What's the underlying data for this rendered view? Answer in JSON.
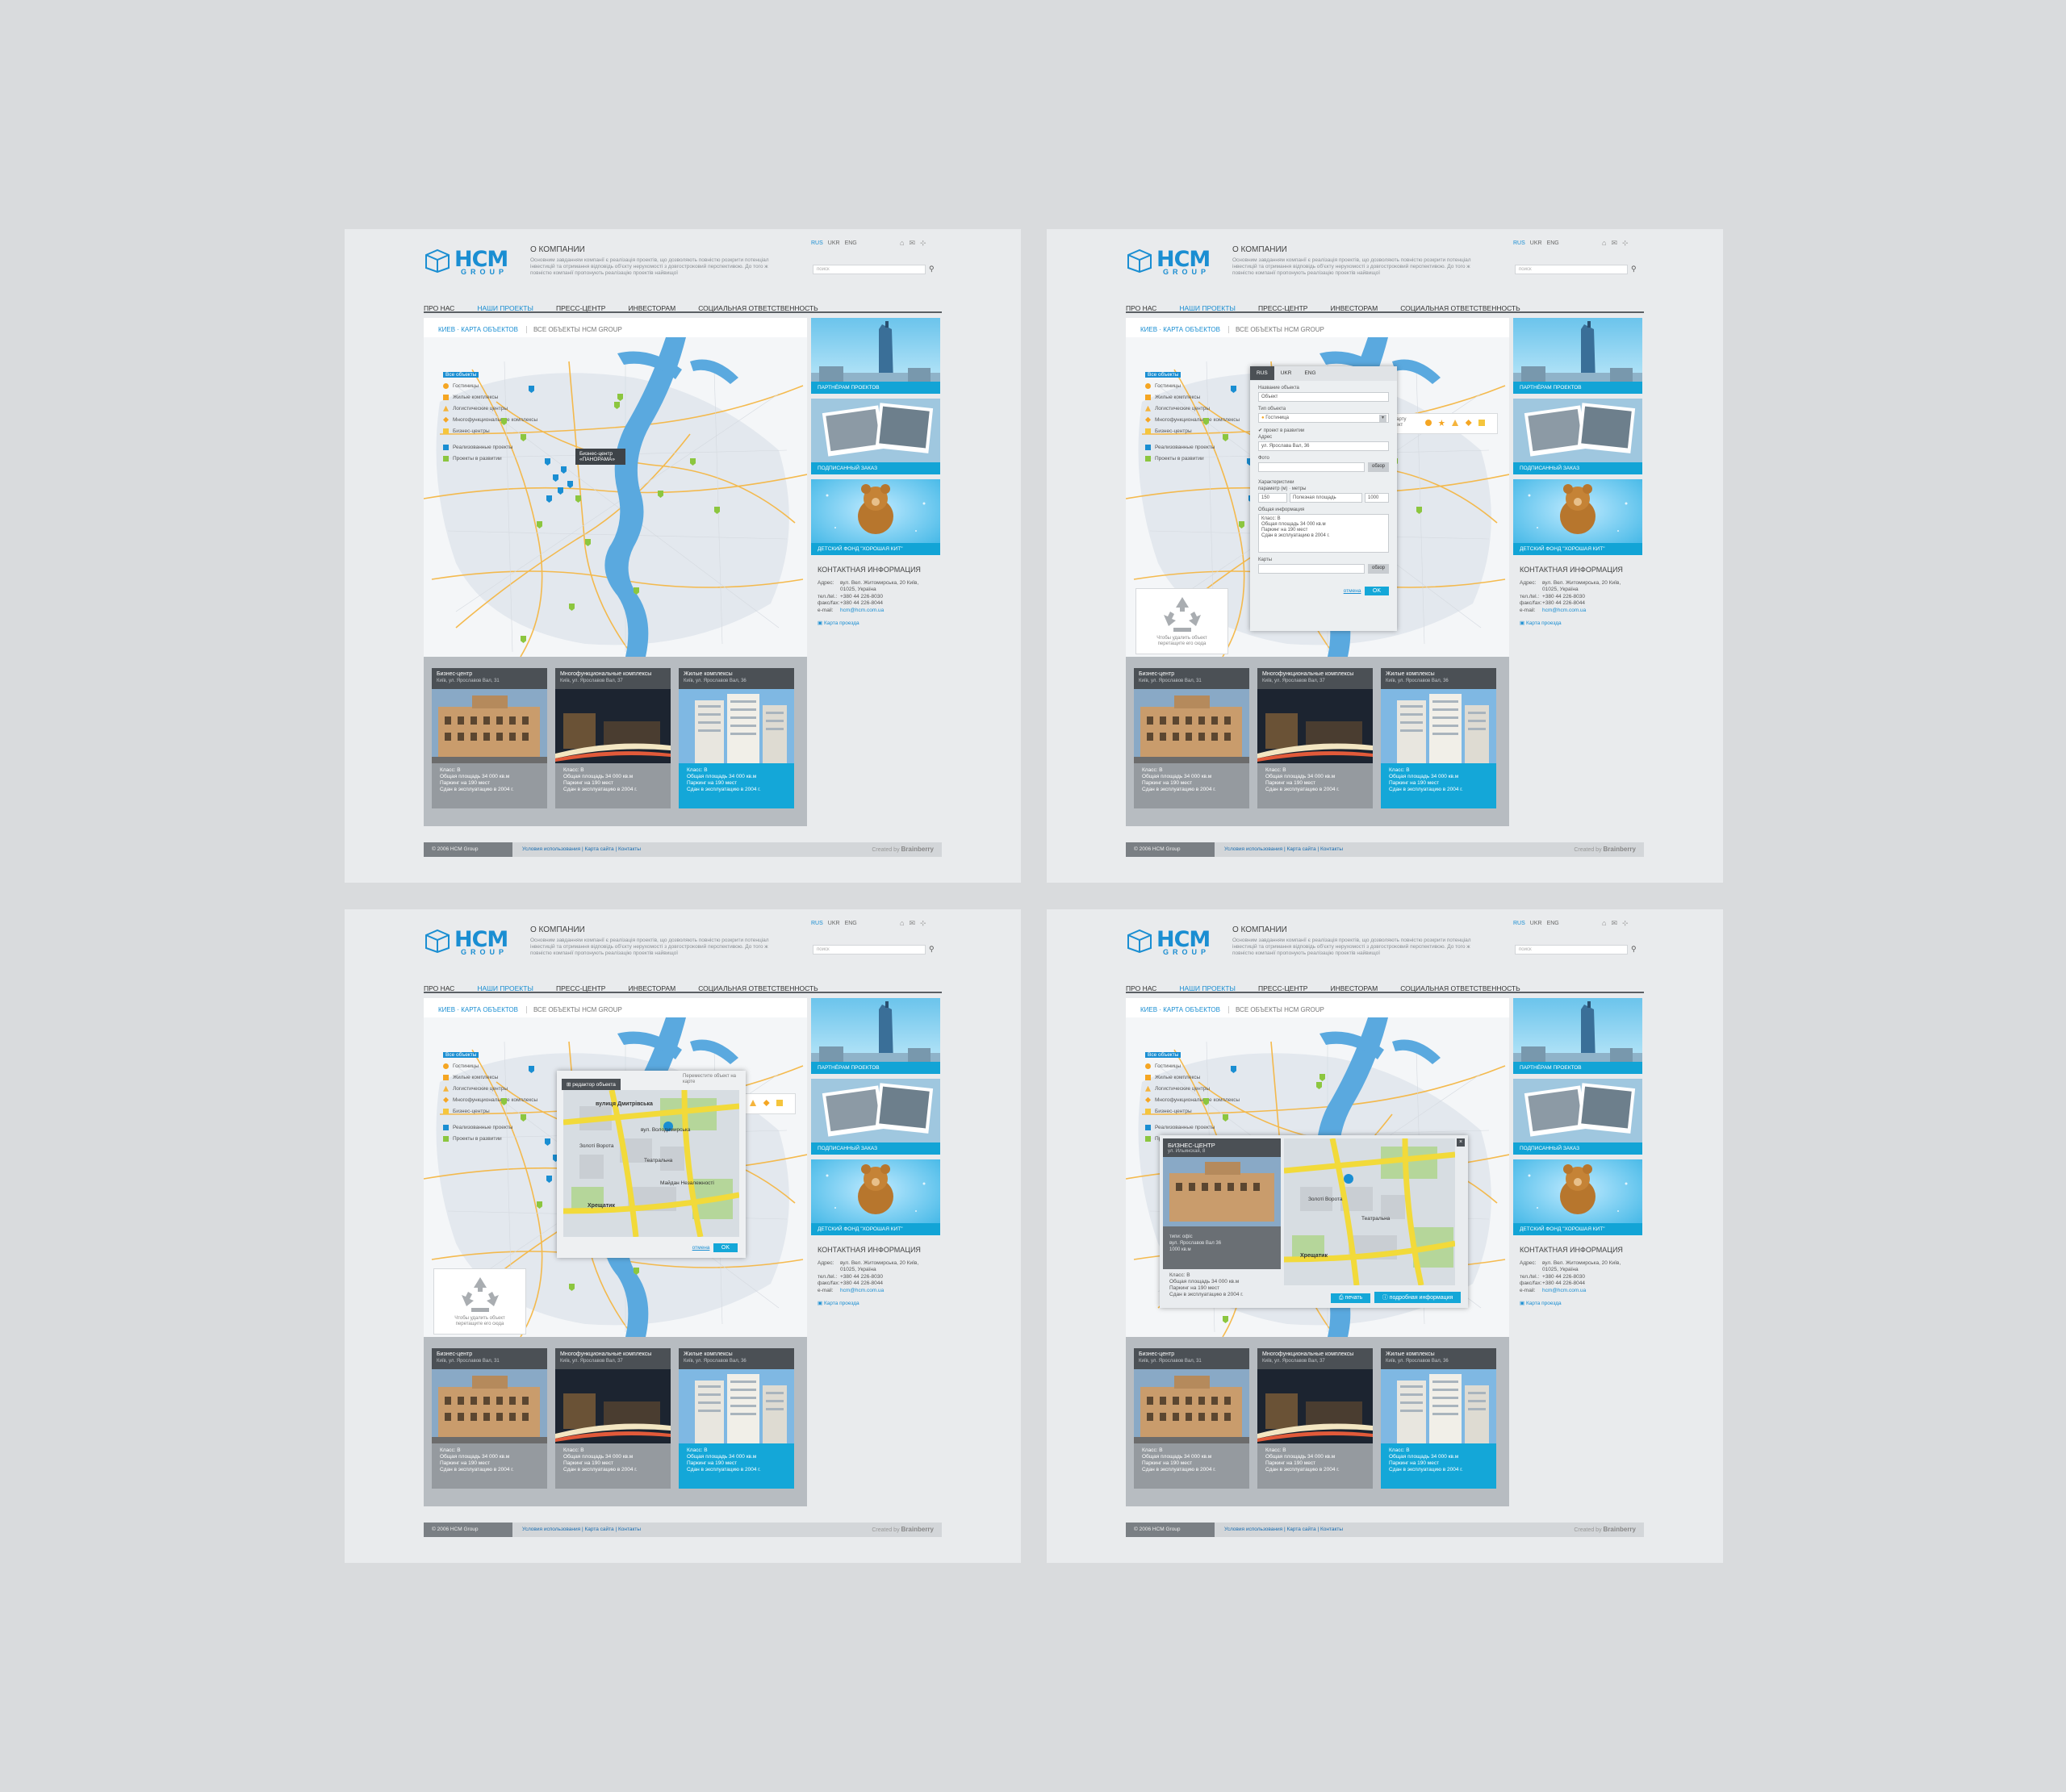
{
  "site": {
    "logo_main": "HCM",
    "logo_sub": "GROUP",
    "about_title": "О КОМПАНИИ",
    "about_text": "Основним завданням компанії є реалізація проектів, що дозволяють повністю розкрити потенціал інвестицій та отримання відповідь об'єкту нерухомості з довгостроковий перспективою. До того ж повністю компанії пропонують реалізацію проектів найвищої",
    "langs": [
      "RUS",
      "UKR",
      "ENG"
    ],
    "search_placeholder": "поиск",
    "nav": [
      "ПРО НАС",
      "НАШИ ПРОЕКТЫ",
      "ПРЕСС-ЦЕНТР",
      "ИНВЕСТОРАМ",
      "СОЦИАЛЬНАЯ ОТВЕТСТВЕННОСТЬ"
    ],
    "crumb_active": "КИЕВ · КАРТА ОБЪЕКТОВ",
    "crumb_other": "ВСЕ ОБЪЕКТЫ HCM GROUP",
    "legend": {
      "all": "Все объекты",
      "items": [
        "Гостиницы",
        "Жилые комплексы",
        "Логистические центры",
        "Многофункциональные комплексы",
        "Бизнес-центры",
        "Реализованные проекты",
        "Проекты в развитии"
      ]
    },
    "map_tooltip": "Бизнес-центр «ПАНОРАМА»",
    "banners": [
      "ПАРТНЁРАМ ПРОЕКТОВ",
      "ПОДПИСАННЫЙ ЗАКАЗ",
      "ДЕТСКИЙ ФОНД \"ХОРОШАЯ КИТ\""
    ],
    "contacts": {
      "title": "КОНТАКТНАЯ ИНФОРМАЦИЯ",
      "rows": [
        {
          "k": "Адрес:",
          "v": "вул. Вел. Житомирська, 20 Київ, 01025, Україна"
        },
        {
          "k": "тел./tel.:",
          "v": "+380 44 226-8030"
        },
        {
          "k": "факс/fax:",
          "v": "+380 44 226-8044"
        },
        {
          "k": "e-mail:",
          "v": "hcm@hcm.com.ua"
        }
      ],
      "map_link": "Карта проезда"
    },
    "cards": [
      {
        "title": "Бизнес-центр",
        "addr": "Київ, ул. Ярославов Вал, 31",
        "info": [
          "Класс: B",
          "Общая площадь 34 000 кв.м",
          "Паркинг на 190 мест",
          "Сдан в эксплуатацию в 2004 г."
        ]
      },
      {
        "title": "Многофункциональные комплексы",
        "addr": "Київ, ул. Ярославов Вал, 37",
        "info": [
          "Класс: B",
          "Общая площадь 34 000 кв.м",
          "Паркинг на 190 мест",
          "Сдан в эксплуатацию в 2004 г."
        ]
      },
      {
        "title": "Жилые комплексы",
        "addr": "Київ, ул. Ярославов Вал, 36",
        "info": [
          "Класс: B",
          "Общая площадь 34 000 кв.м",
          "Паркинг на 190 мест",
          "Сдан в эксплуатацию в 2004 г."
        ]
      }
    ],
    "footer": {
      "copyright": "© 2006 HCM Group",
      "links": "Условия использования | Карта сайта | Контакты",
      "created_by": "Created by",
      "studio": "Brainberry"
    }
  },
  "tools_hint": "Перетащите на карту нужный Вам объект",
  "editor": {
    "tabs": [
      "RUS",
      "UKR",
      "ENG"
    ],
    "name_label": "Название объекта",
    "name_value": "Объект",
    "type_label": "Тип объекта",
    "type_value": "Гостиница",
    "checkbox_label": "проект в развитии",
    "address_label": "Адрес",
    "address_value": "ул. Ярослава Вал, 36",
    "photo_label": "Фото",
    "browse": "обзор",
    "chars_label": "Характеристики",
    "class_label": "параметр (м)",
    "floors_label": "метры",
    "v1": "150",
    "v2": "Полезная площадь",
    "v3": "1000",
    "info_label": "Общая информация",
    "info_text": "Класс: B\nОбщая площадь 34 000 кв.м\nПаркинг на 190 мест\nСдан в эксплуатацию в 2004 г.",
    "video_label": "Карты",
    "cancel": "отмена",
    "ok": "OK"
  },
  "trash_hint": "Чтобы удалить объект перетащите его сюда",
  "map_editor": {
    "title": "редактор объекта",
    "hint": "Переместите объект на карте",
    "streets": [
      "вулиця Дмитрівська",
      "Золоті Ворота",
      "Театральна",
      "вул. Володимирська",
      "Майдан Незалежності",
      "Хрещатик"
    ],
    "cancel": "отмена",
    "ok": "OK"
  },
  "detail": {
    "title": "БИЗНЕС-ЦЕНТР",
    "subtitle": "ул. Ильинская, 8",
    "meta": [
      "типи: офіс",
      "вул. Ярославов Вал 36",
      "1000 кв.м"
    ],
    "info": [
      "Класс: B",
      "Общая площадь 34 000 кв.м",
      "Паркинг на 190 мест",
      "Сдан в эксплуатацию в 2004 г."
    ],
    "btn_print": "печать",
    "btn_more": "подробная информация"
  },
  "colors": {
    "accent": "#14a7d8",
    "brand": "#1a8ed2",
    "river": "#5aa9df",
    "roads": "#f5b43c"
  }
}
